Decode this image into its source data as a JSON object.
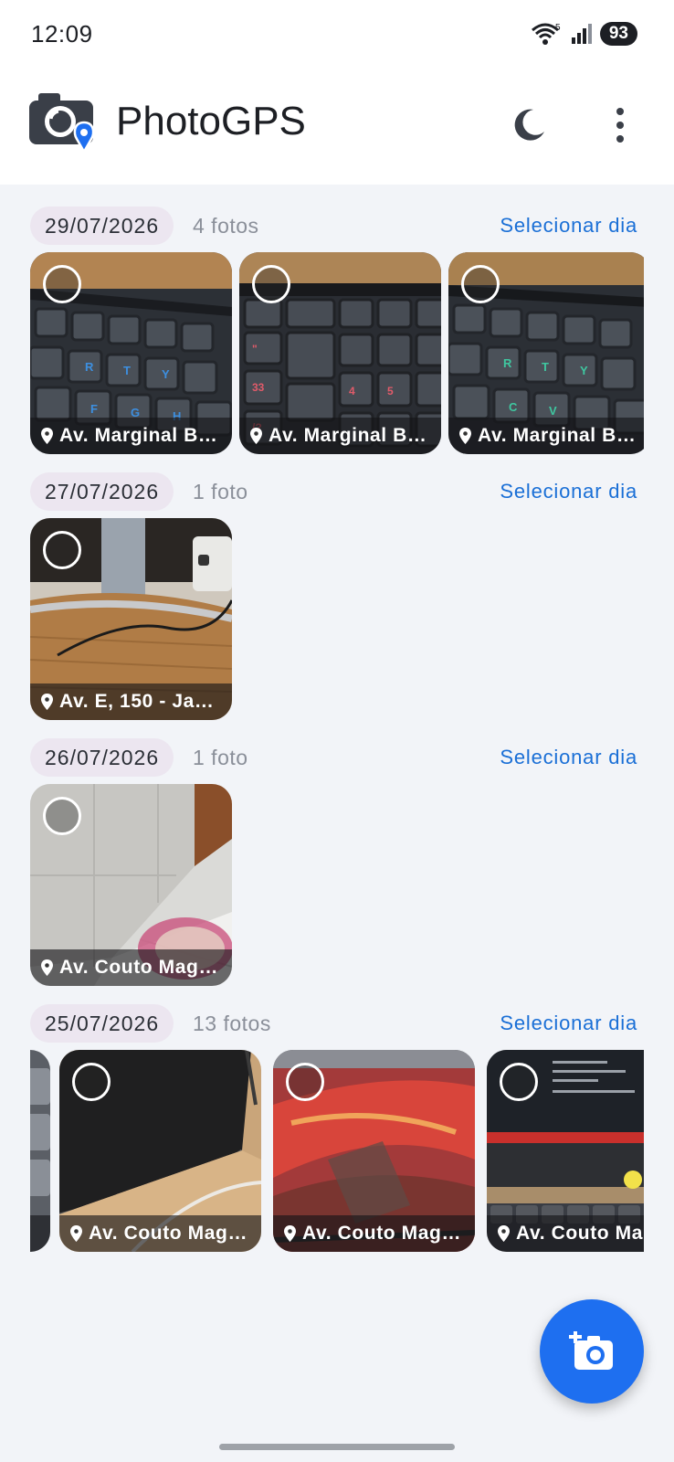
{
  "status": {
    "time": "12:09",
    "battery": "93",
    "signal_badge": "5"
  },
  "app": {
    "title": "PhotoGPS",
    "theme_icon": "moon-icon",
    "menu_icon": "more-vert-icon",
    "logo_icon": "camera-pin-icon"
  },
  "colors": {
    "accent": "#1a6fd6",
    "fab": "#1e6ff0",
    "chip": "#ece6f0",
    "background": "#f2f4f8"
  },
  "groups": [
    {
      "date": "29/07/2026",
      "count": "4 fotos",
      "select_label": "Selecionar dia",
      "photos": [
        {
          "location": "Av. Marginal B…",
          "image": "keyboard-blue-icon"
        },
        {
          "location": "Av. Marginal B…",
          "image": "keyboard-red-icon"
        },
        {
          "location": "Av. Marginal B…",
          "image": "keyboard-green-icon"
        }
      ]
    },
    {
      "date": "27/07/2026",
      "count": "1 foto",
      "select_label": "Selecionar dia",
      "photos": [
        {
          "location": "Av. E, 150 - Ja…",
          "image": "desk-stand-icon"
        }
      ]
    },
    {
      "date": "26/07/2026",
      "count": "1 foto",
      "select_label": "Selecionar dia",
      "photos": [
        {
          "location": "Av. Couto Mag…",
          "image": "floor-tiles-icon"
        }
      ]
    },
    {
      "date": "25/07/2026",
      "count": "13 fotos",
      "select_label": "Selecionar dia",
      "photos": [
        {
          "location": "",
          "image": "partial-keyboard-icon"
        },
        {
          "location": "Av. Couto Mag…",
          "image": "black-bag-icon"
        },
        {
          "location": "Av. Couto Mag…",
          "image": "mousepad-icon"
        },
        {
          "location": "Av. Couto Ma",
          "image": "monitor-icon"
        }
      ]
    }
  ],
  "fab": {
    "icon": "add-photo-icon"
  }
}
